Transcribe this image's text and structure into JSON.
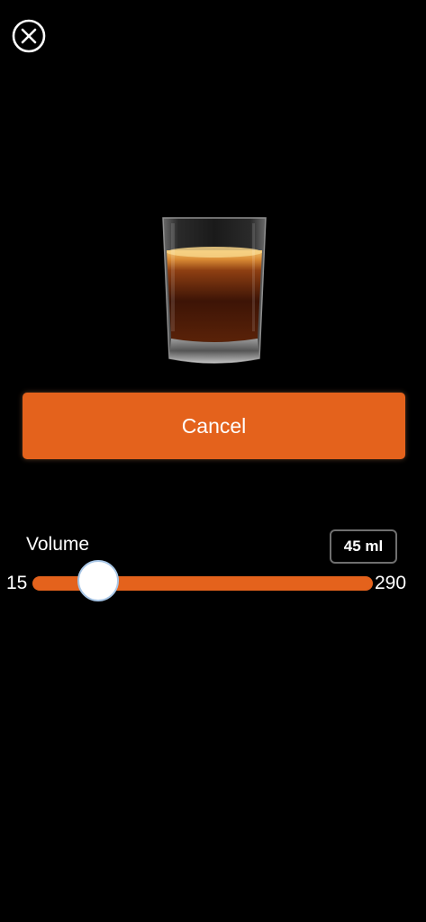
{
  "header": {
    "close_icon": "close-icon"
  },
  "product": {
    "image": "espresso-glass-image"
  },
  "actions": {
    "cancel_label": "Cancel"
  },
  "volume": {
    "label": "Volume",
    "value_text": "45 ml",
    "value": 45,
    "min": 15,
    "max": 290,
    "min_label": "15",
    "max_label": "290",
    "unit": "ml"
  },
  "colors": {
    "accent": "#e4621c",
    "background": "#000000",
    "thumb": "#ffffff",
    "thumb_border": "#a8c6e6"
  }
}
